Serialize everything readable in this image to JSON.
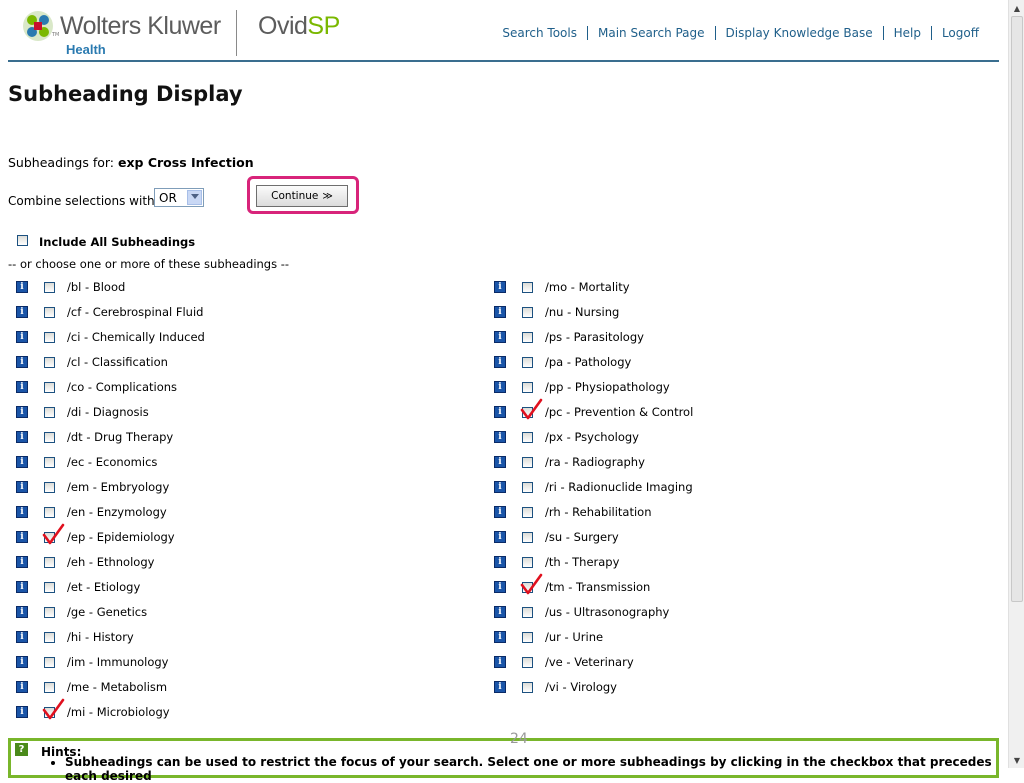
{
  "header": {
    "brand": "Wolters Kluwer",
    "brand_sub": "Health",
    "brand_tm": "TM",
    "product_prefix": "Ovid",
    "product_accent": "SP",
    "nav": [
      "Search Tools",
      "Main Search Page",
      "Display Knowledge Base",
      "Help",
      "Logoff"
    ]
  },
  "page": {
    "title": "Subheading Display",
    "subheadings_for_label": "Subheadings for:",
    "subheadings_for_term": "exp Cross Infection",
    "combine_label": "Combine selections with:",
    "combine_value": "OR",
    "continue_label": "Continue",
    "continue_arrow": "≫",
    "include_all_label": "Include All Subheadings",
    "choose_text": "-- or choose one or more of these subheadings --",
    "page_number": "24"
  },
  "subheadings": {
    "left": [
      {
        "label": "/bl - Blood",
        "checked": false
      },
      {
        "label": "/cf - Cerebrospinal Fluid",
        "checked": false
      },
      {
        "label": "/ci - Chemically Induced",
        "checked": false
      },
      {
        "label": "/cl - Classification",
        "checked": false
      },
      {
        "label": "/co - Complications",
        "checked": false
      },
      {
        "label": "/di - Diagnosis",
        "checked": false
      },
      {
        "label": "/dt - Drug Therapy",
        "checked": false
      },
      {
        "label": "/ec - Economics",
        "checked": false
      },
      {
        "label": "/em - Embryology",
        "checked": false
      },
      {
        "label": "/en - Enzymology",
        "checked": false
      },
      {
        "label": "/ep - Epidemiology",
        "checked": true
      },
      {
        "label": "/eh - Ethnology",
        "checked": false
      },
      {
        "label": "/et - Etiology",
        "checked": false
      },
      {
        "label": "/ge - Genetics",
        "checked": false
      },
      {
        "label": "/hi - History",
        "checked": false
      },
      {
        "label": "/im - Immunology",
        "checked": false
      },
      {
        "label": "/me - Metabolism",
        "checked": false
      },
      {
        "label": "/mi - Microbiology",
        "checked": true
      }
    ],
    "right": [
      {
        "label": "/mo - Mortality",
        "checked": false
      },
      {
        "label": "/nu - Nursing",
        "checked": false
      },
      {
        "label": "/ps - Parasitology",
        "checked": false
      },
      {
        "label": "/pa - Pathology",
        "checked": false
      },
      {
        "label": "/pp - Physiopathology",
        "checked": false
      },
      {
        "label": "/pc - Prevention & Control",
        "checked": true
      },
      {
        "label": "/px - Psychology",
        "checked": false
      },
      {
        "label": "/ra - Radiography",
        "checked": false
      },
      {
        "label": "/ri - Radionuclide Imaging",
        "checked": false
      },
      {
        "label": "/rh - Rehabilitation",
        "checked": false
      },
      {
        "label": "/su - Surgery",
        "checked": false
      },
      {
        "label": "/th - Therapy",
        "checked": false
      },
      {
        "label": "/tm - Transmission",
        "checked": true
      },
      {
        "label": "/us - Ultrasonography",
        "checked": false
      },
      {
        "label": "/ur - Urine",
        "checked": false
      },
      {
        "label": "/ve - Veterinary",
        "checked": false
      },
      {
        "label": "/vi - Virology",
        "checked": false
      }
    ]
  },
  "hints": {
    "icon": "?",
    "title": "Hints:",
    "items": [
      "Subheadings can be used to restrict the focus of your search. Select one or more subheadings by clicking in the checkbox that precedes each desired"
    ]
  },
  "colors": {
    "header_rule": "#3a6e8f",
    "nav_link": "#1f5f8a",
    "highlight_ring": "#d8247a",
    "hints_border": "#79b62b",
    "check_mark": "#e0101e",
    "info_icon": "#1a55a8"
  },
  "icons": {
    "info": "info-icon",
    "check": "check-mark-icon",
    "logo": "wolters-kluwer-logo-icon",
    "help": "question-icon"
  }
}
